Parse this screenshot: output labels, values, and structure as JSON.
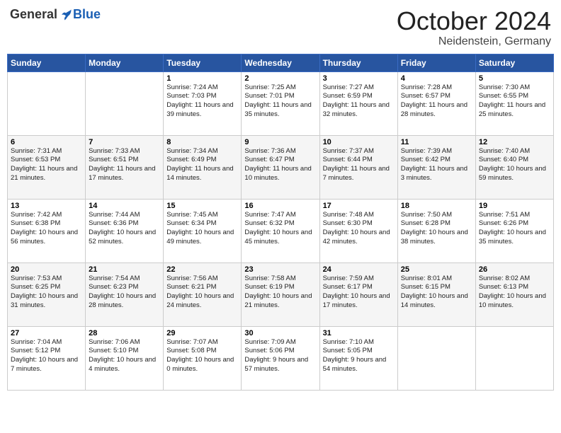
{
  "header": {
    "logo": {
      "general": "General",
      "blue": "Blue"
    },
    "title": "October 2024",
    "location": "Neidenstein, Germany"
  },
  "weekdays": [
    "Sunday",
    "Monday",
    "Tuesday",
    "Wednesday",
    "Thursday",
    "Friday",
    "Saturday"
  ],
  "weeks": [
    [
      {
        "day": "",
        "info": ""
      },
      {
        "day": "",
        "info": ""
      },
      {
        "day": "1",
        "info": "Sunrise: 7:24 AM\nSunset: 7:03 PM\nDaylight: 11 hours and 39 minutes."
      },
      {
        "day": "2",
        "info": "Sunrise: 7:25 AM\nSunset: 7:01 PM\nDaylight: 11 hours and 35 minutes."
      },
      {
        "day": "3",
        "info": "Sunrise: 7:27 AM\nSunset: 6:59 PM\nDaylight: 11 hours and 32 minutes."
      },
      {
        "day": "4",
        "info": "Sunrise: 7:28 AM\nSunset: 6:57 PM\nDaylight: 11 hours and 28 minutes."
      },
      {
        "day": "5",
        "info": "Sunrise: 7:30 AM\nSunset: 6:55 PM\nDaylight: 11 hours and 25 minutes."
      }
    ],
    [
      {
        "day": "6",
        "info": "Sunrise: 7:31 AM\nSunset: 6:53 PM\nDaylight: 11 hours and 21 minutes."
      },
      {
        "day": "7",
        "info": "Sunrise: 7:33 AM\nSunset: 6:51 PM\nDaylight: 11 hours and 17 minutes."
      },
      {
        "day": "8",
        "info": "Sunrise: 7:34 AM\nSunset: 6:49 PM\nDaylight: 11 hours and 14 minutes."
      },
      {
        "day": "9",
        "info": "Sunrise: 7:36 AM\nSunset: 6:47 PM\nDaylight: 11 hours and 10 minutes."
      },
      {
        "day": "10",
        "info": "Sunrise: 7:37 AM\nSunset: 6:44 PM\nDaylight: 11 hours and 7 minutes."
      },
      {
        "day": "11",
        "info": "Sunrise: 7:39 AM\nSunset: 6:42 PM\nDaylight: 11 hours and 3 minutes."
      },
      {
        "day": "12",
        "info": "Sunrise: 7:40 AM\nSunset: 6:40 PM\nDaylight: 10 hours and 59 minutes."
      }
    ],
    [
      {
        "day": "13",
        "info": "Sunrise: 7:42 AM\nSunset: 6:38 PM\nDaylight: 10 hours and 56 minutes."
      },
      {
        "day": "14",
        "info": "Sunrise: 7:44 AM\nSunset: 6:36 PM\nDaylight: 10 hours and 52 minutes."
      },
      {
        "day": "15",
        "info": "Sunrise: 7:45 AM\nSunset: 6:34 PM\nDaylight: 10 hours and 49 minutes."
      },
      {
        "day": "16",
        "info": "Sunrise: 7:47 AM\nSunset: 6:32 PM\nDaylight: 10 hours and 45 minutes."
      },
      {
        "day": "17",
        "info": "Sunrise: 7:48 AM\nSunset: 6:30 PM\nDaylight: 10 hours and 42 minutes."
      },
      {
        "day": "18",
        "info": "Sunrise: 7:50 AM\nSunset: 6:28 PM\nDaylight: 10 hours and 38 minutes."
      },
      {
        "day": "19",
        "info": "Sunrise: 7:51 AM\nSunset: 6:26 PM\nDaylight: 10 hours and 35 minutes."
      }
    ],
    [
      {
        "day": "20",
        "info": "Sunrise: 7:53 AM\nSunset: 6:25 PM\nDaylight: 10 hours and 31 minutes."
      },
      {
        "day": "21",
        "info": "Sunrise: 7:54 AM\nSunset: 6:23 PM\nDaylight: 10 hours and 28 minutes."
      },
      {
        "day": "22",
        "info": "Sunrise: 7:56 AM\nSunset: 6:21 PM\nDaylight: 10 hours and 24 minutes."
      },
      {
        "day": "23",
        "info": "Sunrise: 7:58 AM\nSunset: 6:19 PM\nDaylight: 10 hours and 21 minutes."
      },
      {
        "day": "24",
        "info": "Sunrise: 7:59 AM\nSunset: 6:17 PM\nDaylight: 10 hours and 17 minutes."
      },
      {
        "day": "25",
        "info": "Sunrise: 8:01 AM\nSunset: 6:15 PM\nDaylight: 10 hours and 14 minutes."
      },
      {
        "day": "26",
        "info": "Sunrise: 8:02 AM\nSunset: 6:13 PM\nDaylight: 10 hours and 10 minutes."
      }
    ],
    [
      {
        "day": "27",
        "info": "Sunrise: 7:04 AM\nSunset: 5:12 PM\nDaylight: 10 hours and 7 minutes."
      },
      {
        "day": "28",
        "info": "Sunrise: 7:06 AM\nSunset: 5:10 PM\nDaylight: 10 hours and 4 minutes."
      },
      {
        "day": "29",
        "info": "Sunrise: 7:07 AM\nSunset: 5:08 PM\nDaylight: 10 hours and 0 minutes."
      },
      {
        "day": "30",
        "info": "Sunrise: 7:09 AM\nSunset: 5:06 PM\nDaylight: 9 hours and 57 minutes."
      },
      {
        "day": "31",
        "info": "Sunrise: 7:10 AM\nSunset: 5:05 PM\nDaylight: 9 hours and 54 minutes."
      },
      {
        "day": "",
        "info": ""
      },
      {
        "day": "",
        "info": ""
      }
    ]
  ]
}
